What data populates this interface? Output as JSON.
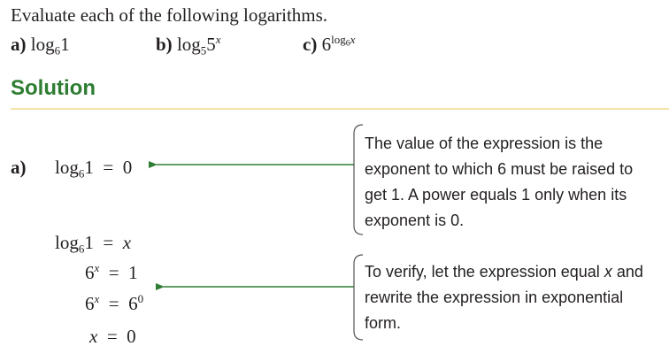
{
  "problem": {
    "title": "Evaluate each of the following logarithms.",
    "parts": [
      {
        "label": "a)",
        "base_text": "log",
        "subscript": "6",
        "argument": "1"
      },
      {
        "label": "b)",
        "base_text": "log",
        "subscript": "5",
        "argument": "5",
        "exponent": "x"
      },
      {
        "label": "c)",
        "base_text": "6",
        "exponent_log": "log",
        "exponent_sub": "6",
        "exponent_arg": "x"
      }
    ]
  },
  "solution": {
    "heading": "Solution",
    "part_a": {
      "label": "a)",
      "equation": {
        "log": "log",
        "sub": "6",
        "arg": "1",
        "rel": "=",
        "rhs": "0"
      },
      "steps": [
        {
          "lhs_log": "log",
          "lhs_sub": "6",
          "lhs_arg": "1",
          "rel": "=",
          "rhs": "x"
        },
        {
          "lhs_base": "6",
          "lhs_exp": "x",
          "rel": "=",
          "rhs": "1"
        },
        {
          "lhs_base": "6",
          "lhs_exp": "x",
          "rel": "=",
          "rhs_base": "6",
          "rhs_exp": "0"
        },
        {
          "lhs": "x",
          "rel": "=",
          "rhs": "0"
        }
      ]
    },
    "notes": [
      {
        "text": "The value of the expression is the exponent to which 6 must be raised to get 1. A power equals 1 only when its exponent is 0."
      },
      {
        "text_before": "To verify, let the expression equal ",
        "variable": "x",
        "text_after": " and rewrite the expression in exponential form."
      }
    ]
  },
  "colors": {
    "heading": "#2e7d32",
    "arrow": "#2e7d32",
    "rule": "#f2e3a8",
    "text": "#231f20",
    "bracket": "#555555"
  }
}
